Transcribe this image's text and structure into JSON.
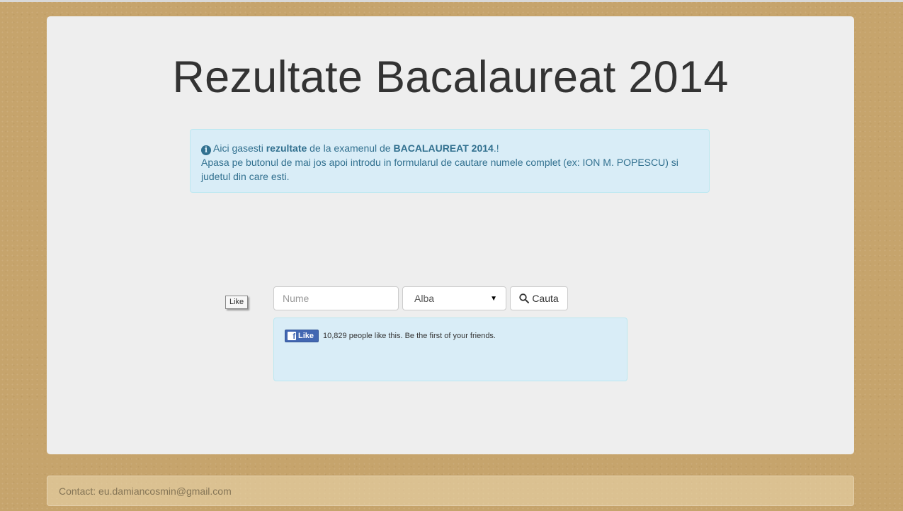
{
  "page": {
    "title": "Rezultate Bacalaureat 2014"
  },
  "info": {
    "icon": "info-circle-icon",
    "line1_prefix": "Aici gasesti ",
    "line1_bold1": "rezultate",
    "line1_mid": " de la examenul de ",
    "line1_bold2": "BACALAUREAT 2014",
    "line1_suffix": ".!",
    "line2": "Apasa pe butonul de mai jos apoi introdu in formularul de cautare numele complet (ex: ION M. POPESCU) si judetul din care esti."
  },
  "search": {
    "name_placeholder": "Nume",
    "name_value": "",
    "county_selected": "Alba",
    "button_label": "Cauta"
  },
  "like_floating_label": "Like",
  "facebook": {
    "button_label": "Like",
    "icon_glyph": "f",
    "text": "10,829 people like this. Be the first of your friends."
  },
  "footer": {
    "contact": "Contact: eu.damiancosmin@gmail.com"
  },
  "colors": {
    "background": "#c6a46c",
    "card": "#eeeeee",
    "info_bg": "#d9edf7",
    "info_text": "#31708f",
    "facebook_blue": "#4267b2"
  }
}
